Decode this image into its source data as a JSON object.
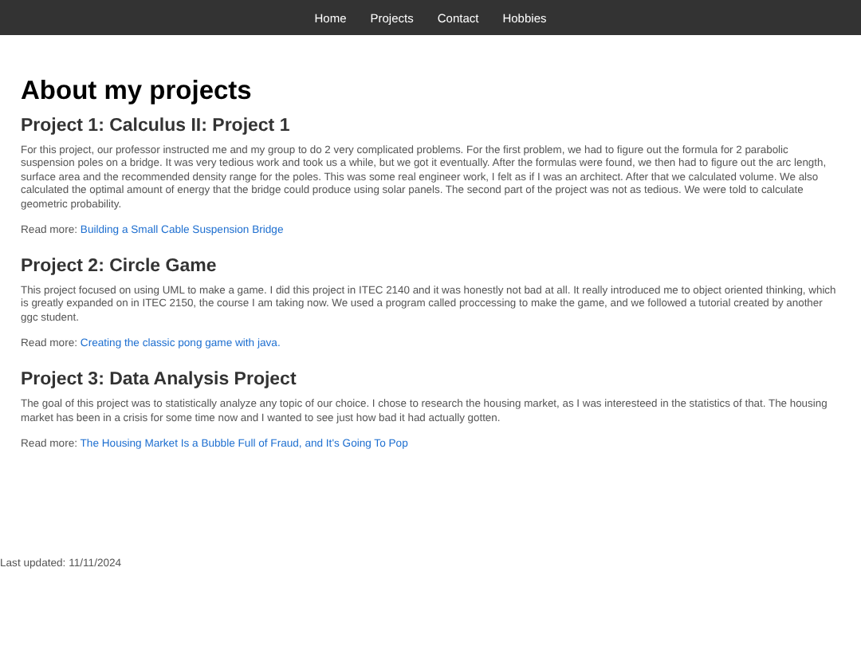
{
  "nav": [
    "Home",
    "Projects",
    "Contact",
    "Hobbies"
  ],
  "title": "About my projects",
  "projects": [
    {
      "heading": "Project 1: Calculus II: Project 1",
      "text": "For this project, our professor instructed me and my group to do 2 very complicated problems. For the first problem, we had to figure out the formula for 2 parabolic suspension poles on a bridge. It was very tedious work and took us a while, but we got it eventually. After the formulas were found, we then had to figure out the arc length, surface area and the recommended density range for the poles. This was some real engineer work, I felt as if I was an architect. After that we calculated volume. We also calculated the optimal amount of energy that the bridge could produce using solar panels. The second part of the project was not as tedious. We were told to calculate geometric probability.",
      "read_more": "Read more:",
      "link": "Building a Small Cable Suspension Bridge"
    },
    {
      "heading": "Project 2: Circle Game",
      "text": "This project focused on using UML to make a game. I did this project in ITEC 2140 and it was honestly not bad at all. It really introduced me to object oriented thinking, which is greatly expanded on in ITEC 2150, the course I am taking now. We used a program called proccessing to make the game, and we followed a tutorial created by another ggc student.",
      "read_more": "Read more:",
      "link": "Creating the classic pong game with java."
    },
    {
      "heading": "Project 3: Data Analysis Project",
      "text": "The goal of this project was to statistically analyze any topic of our choice. I chose to research the housing market, as I was interesteed in the statistics of that. The housing market has been in a crisis for some time now and I wanted to see just how bad it had actually gotten.",
      "read_more": "Read more:",
      "link": "The Housing Market Is a Bubble Full of Fraud, and It's Going To Pop"
    }
  ],
  "footer": "Last updated: 11/11/2024"
}
